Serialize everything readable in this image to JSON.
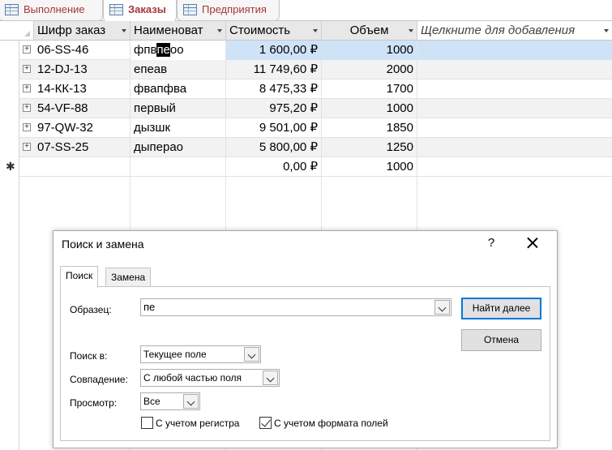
{
  "tabs": [
    {
      "label": "Выполнение",
      "icon": "table-icon"
    },
    {
      "label": "Заказы",
      "icon": "table-icon",
      "active": true
    },
    {
      "label": "Предприятия",
      "icon": "table-icon"
    }
  ],
  "table": {
    "columns": [
      "Шифр заказ",
      "Наименоват",
      "Стоимость",
      "Объем",
      "Щелкните для добавления"
    ],
    "rows": [
      {
        "code": "06-SS-46",
        "name_before": "фпв",
        "name_highlight": "пе",
        "name_after": "оо",
        "cost": "1 600,00 ₽",
        "volume": "1000"
      },
      {
        "code": "12-DJ-13",
        "name": "епеав",
        "cost": "11 749,60 ₽",
        "volume": "2000"
      },
      {
        "code": "14-КК-13",
        "name": "фвапфва",
        "cost": "8 475,33 ₽",
        "volume": "1700"
      },
      {
        "code": "54-VF-88",
        "name": "первый",
        "cost": "975,20 ₽",
        "volume": "1000"
      },
      {
        "code": "97-QW-32",
        "name": "дызшк",
        "cost": "9 501,00 ₽",
        "volume": "1850"
      },
      {
        "code": "07-SS-25",
        "name": "дыперао",
        "cost": "5 800,00 ₽",
        "volume": "1250"
      }
    ],
    "new_row": {
      "marker": "✱",
      "cost": "0,00 ₽",
      "volume": "1000"
    }
  },
  "dialog": {
    "title": "Поиск и замена",
    "help": "?",
    "tabs": [
      "Поиск",
      "Замена"
    ],
    "pattern_label": "Образец:",
    "pattern_value": "пе",
    "find_next": "Найти далее",
    "cancel": "Отмена",
    "search_in_label": "Поиск в:",
    "search_in_value": "Текущее поле",
    "match_label": "Совпадение:",
    "match_value": "С любой частью поля",
    "direction_label": "Просмотр:",
    "direction_value": "Все",
    "match_case_label": "С учетом регистра",
    "match_case_checked": false,
    "format_label": "С учетом формата полей",
    "format_checked": true
  },
  "colors": {
    "tab_text": "#a4373a",
    "selected_cell": "#cfe3f7",
    "accent": "#0078d7"
  }
}
